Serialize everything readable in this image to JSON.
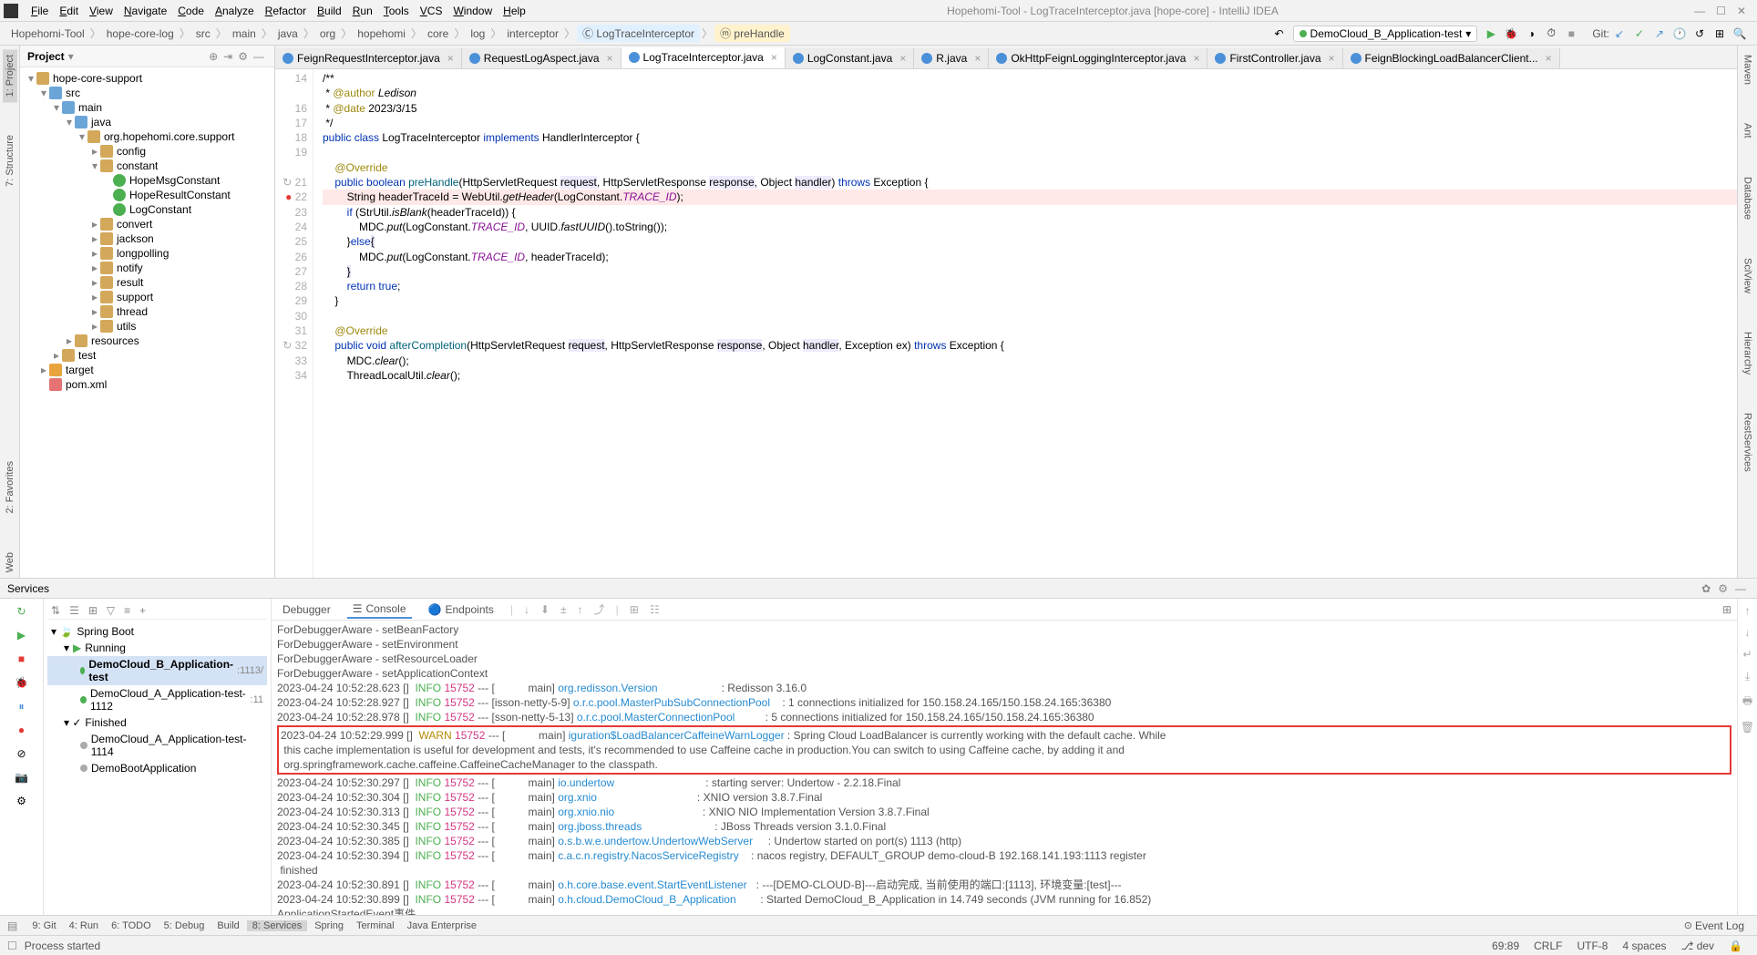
{
  "window_title": "Hopehomi-Tool - LogTraceInterceptor.java [hope-core] - IntelliJ IDEA",
  "menus": [
    "File",
    "Edit",
    "View",
    "Navigate",
    "Code",
    "Analyze",
    "Refactor",
    "Build",
    "Run",
    "Tools",
    "VCS",
    "Window",
    "Help"
  ],
  "breadcrumbs": [
    "Hopehomi-Tool",
    "hope-core-log",
    "src",
    "main",
    "java",
    "org",
    "hopehomi",
    "core",
    "log",
    "interceptor"
  ],
  "breadcrumb_class": "LogTraceInterceptor",
  "breadcrumb_method": "preHandle",
  "run_config": "DemoCloud_B_Application-test",
  "git_label": "Git:",
  "left_tabs": [
    "1: Project",
    "7: Structure"
  ],
  "right_tabs": [
    "Maven",
    "Ant",
    "Database",
    "SciView",
    "Hierarchy",
    "RestServices"
  ],
  "left_tabs2": [
    "2: Favorites",
    "Web"
  ],
  "project_panel_title": "Project",
  "tree": [
    {
      "indent": 0,
      "arrow": "▾",
      "icon": "folder",
      "label": "hope-core-support"
    },
    {
      "indent": 1,
      "arrow": "▾",
      "icon": "folder-blue",
      "label": "src"
    },
    {
      "indent": 2,
      "arrow": "▾",
      "icon": "folder-blue",
      "label": "main"
    },
    {
      "indent": 3,
      "arrow": "▾",
      "icon": "folder-blue",
      "label": "java"
    },
    {
      "indent": 4,
      "arrow": "▾",
      "icon": "folder",
      "label": "org.hopehomi.core.support"
    },
    {
      "indent": 5,
      "arrow": "▸",
      "icon": "folder",
      "label": "config"
    },
    {
      "indent": 5,
      "arrow": "▾",
      "icon": "folder",
      "label": "constant"
    },
    {
      "indent": 6,
      "arrow": "",
      "icon": "class-c",
      "label": "HopeMsgConstant"
    },
    {
      "indent": 6,
      "arrow": "",
      "icon": "class-c",
      "label": "HopeResultConstant"
    },
    {
      "indent": 6,
      "arrow": "",
      "icon": "class-c",
      "label": "LogConstant"
    },
    {
      "indent": 5,
      "arrow": "▸",
      "icon": "folder",
      "label": "convert"
    },
    {
      "indent": 5,
      "arrow": "▸",
      "icon": "folder",
      "label": "jackson"
    },
    {
      "indent": 5,
      "arrow": "▸",
      "icon": "folder",
      "label": "longpolling"
    },
    {
      "indent": 5,
      "arrow": "▸",
      "icon": "folder",
      "label": "notify"
    },
    {
      "indent": 5,
      "arrow": "▸",
      "icon": "folder",
      "label": "result"
    },
    {
      "indent": 5,
      "arrow": "▸",
      "icon": "folder",
      "label": "support"
    },
    {
      "indent": 5,
      "arrow": "▸",
      "icon": "folder",
      "label": "thread"
    },
    {
      "indent": 5,
      "arrow": "▸",
      "icon": "folder",
      "label": "utils"
    },
    {
      "indent": 3,
      "arrow": "▸",
      "icon": "folder",
      "label": "resources"
    },
    {
      "indent": 2,
      "arrow": "▸",
      "icon": "folder",
      "label": "test"
    },
    {
      "indent": 1,
      "arrow": "▸",
      "icon": "folder-orange",
      "label": "target"
    },
    {
      "indent": 1,
      "arrow": "",
      "icon": "xml",
      "label": "pom.xml"
    }
  ],
  "tabs": [
    {
      "label": "FeignRequestInterceptor.java",
      "active": false
    },
    {
      "label": "RequestLogAspect.java",
      "active": false
    },
    {
      "label": "LogTraceInterceptor.java",
      "active": true
    },
    {
      "label": "LogConstant.java",
      "active": false
    },
    {
      "label": "R.java",
      "active": false
    },
    {
      "label": "OkHttpFeignLoggingInterceptor.java",
      "active": false
    },
    {
      "label": "FirstController.java",
      "active": false
    },
    {
      "label": "FeignBlockingLoadBalancerClient...",
      "active": false
    }
  ],
  "code_lines": [
    {
      "n": 14,
      "html": "/**"
    },
    {
      "n": "",
      "html": " * <span class='anno'>@author</span> <i>Ledison</i>"
    },
    {
      "n": 16,
      "html": " * <span class='anno'>@date</span> 2023/3/15"
    },
    {
      "n": 17,
      "html": " */"
    },
    {
      "n": 18,
      "html": "<span class='kw'>public class</span> LogTraceInterceptor <span class='kw'>implements</span> HandlerInterceptor {"
    },
    {
      "n": 19,
      "html": ""
    },
    {
      "n": "",
      "html": "    <span class='anno'>@Override</span>"
    },
    {
      "n": 21,
      "html": "    <span class='kw'>public boolean</span> <span class='method-name'>preHandle</span>(HttpServletRequest <span class='hl-param'>request</span>, HttpServletResponse <span class='hl-param'>response</span>, Object <span class='hl-param'>handler</span>) <span class='kw'>throws</span> Exception {",
      "icon": "↻"
    },
    {
      "n": 22,
      "html": "        String headerTraceId = WebUtil.<i>getHeader</i>(LogConstant.<span class='field'>TRACE_ID</span>);",
      "bp": true
    },
    {
      "n": 23,
      "html": "        <span class='kw'>if</span> (StrUtil.<i>isBlank</i>(headerTraceId)) {"
    },
    {
      "n": 24,
      "html": "            MDC.<i>put</i>(LogConstant.<span class='field'>TRACE_ID</span>, UUID.<i>fastUUID</i>().toString());"
    },
    {
      "n": 25,
      "html": "        }<span class='kw'>else</span><span class='hl'>{</span>"
    },
    {
      "n": 26,
      "html": "            MDC.<i>put</i>(LogConstant.<span class='field'>TRACE_ID</span>, headerTraceId);"
    },
    {
      "n": 27,
      "html": "        <span class='hl'>}</span>"
    },
    {
      "n": 28,
      "html": "        <span class='kw'>return true</span>;"
    },
    {
      "n": 29,
      "html": "    }"
    },
    {
      "n": 30,
      "html": ""
    },
    {
      "n": 31,
      "html": "    <span class='anno'>@Override</span>"
    },
    {
      "n": 32,
      "html": "    <span class='kw'>public void</span> <span class='method-name'>afterCompletion</span>(HttpServletRequest <span class='hl-param'>request</span>, HttpServletResponse <span class='hl-param'>response</span>, Object <span class='hl-param'>handler</span>, Exception ex) <span class='kw'>throws</span> Exception {",
      "icon": "↻"
    },
    {
      "n": 33,
      "html": "        MDC.<i>clear</i>();"
    },
    {
      "n": 34,
      "html": "        ThreadLocalUtil.<i>clear</i>();"
    }
  ],
  "services_title": "Services",
  "services_tree_title": "Spring Boot",
  "services_running": "Running",
  "services_finished": "Finished",
  "services_items_running": [
    {
      "label": "DemoCloud_B_Application-test",
      "port": ":1113/",
      "selected": true
    },
    {
      "label": "DemoCloud_A_Application-test-1112",
      "port": ":11",
      "selected": false
    }
  ],
  "services_items_finished": [
    {
      "label": "DemoCloud_A_Application-test-1114"
    },
    {
      "label": "DemoBootApplication"
    }
  ],
  "console_tabs": [
    "Debugger",
    "Console",
    "Endpoints"
  ],
  "console_lines": [
    {
      "raw": "<span class='log-text'>ForDebuggerAware - setBeanFactory</span>"
    },
    {
      "raw": "<span class='log-text'>ForDebuggerAware - setEnvironment</span>"
    },
    {
      "raw": "<span class='log-text'>ForDebuggerAware - setResourceLoader</span>"
    },
    {
      "raw": "<span class='log-text'>ForDebuggerAware - setApplicationContext</span>"
    },
    {
      "raw": "<span class='log-text'>2023-04-24 10:52:28.623 []  </span><span class='log-info'>INFO</span> <span class='log-pid'>15752</span><span class='log-text'> --- [           main] </span><span class='log-logger'>org.redisson.Version</span><span class='log-text'>                     : Redisson 3.16.0</span>"
    },
    {
      "raw": "<span class='log-text'>2023-04-24 10:52:28.927 []  </span><span class='log-info'>INFO</span> <span class='log-pid'>15752</span><span class='log-text'> --- [isson-netty-5-9] </span><span class='log-logger'>o.r.c.pool.MasterPubSubConnectionPool</span><span class='log-text'>    : 1 connections initialized for 150.158.24.165/150.158.24.165:36380</span>"
    },
    {
      "raw": "<span class='log-text'>2023-04-24 10:52:28.978 []  </span><span class='log-info'>INFO</span> <span class='log-pid'>15752</span><span class='log-text'> --- [sson-netty-5-13] </span><span class='log-logger'>o.r.c.pool.MasterConnectionPool</span><span class='log-text'>          : 5 connections initialized for 150.158.24.165/150.158.24.165:36380</span>"
    },
    {
      "box": true,
      "raw": "<span class='log-text'>2023-04-24 10:52:29.999 []  </span><span class='log-warn'>WARN</span> <span class='log-pid'>15752</span><span class='log-text'> --- [           main] </span><span class='log-logger'>iguration$LoadBalancerCaffeineWarnLogger</span><span class='log-text'> : Spring Cloud LoadBalancer is currently working with the default cache. While \n this cache implementation is useful for development and tests, it's recommended to use Caffeine cache in production.You can switch to using Caffeine cache, by adding it and \n org.springframework.cache.caffeine.CaffeineCacheManager to the classpath.</span>"
    },
    {
      "raw": "<span class='log-text'>2023-04-24 10:52:30.297 []  </span><span class='log-info'>INFO</span> <span class='log-pid'>15752</span><span class='log-text'> --- [           main] </span><span class='log-logger'>io.undertow</span><span class='log-text'>                              : starting server: Undertow - 2.2.18.Final</span>"
    },
    {
      "raw": "<span class='log-text'>2023-04-24 10:52:30.304 []  </span><span class='log-info'>INFO</span> <span class='log-pid'>15752</span><span class='log-text'> --- [           main] </span><span class='log-logger'>org.xnio</span><span class='log-text'>                                 : XNIO version 3.8.7.Final</span>"
    },
    {
      "raw": "<span class='log-text'>2023-04-24 10:52:30.313 []  </span><span class='log-info'>INFO</span> <span class='log-pid'>15752</span><span class='log-text'> --- [           main] </span><span class='log-logger'>org.xnio.nio</span><span class='log-text'>                             : XNIO NIO Implementation Version 3.8.7.Final</span>"
    },
    {
      "raw": "<span class='log-text'>2023-04-24 10:52:30.345 []  </span><span class='log-info'>INFO</span> <span class='log-pid'>15752</span><span class='log-text'> --- [           main] </span><span class='log-logger'>org.jboss.threads</span><span class='log-text'>                        : JBoss Threads version 3.1.0.Final</span>"
    },
    {
      "raw": "<span class='log-text'>2023-04-24 10:52:30.385 []  </span><span class='log-info'>INFO</span> <span class='log-pid'>15752</span><span class='log-text'> --- [           main] </span><span class='log-logger'>o.s.b.w.e.undertow.UndertowWebServer</span><span class='log-text'>     : Undertow started on port(s) 1113 (http)</span>"
    },
    {
      "raw": "<span class='log-text'>2023-04-24 10:52:30.394 []  </span><span class='log-info'>INFO</span> <span class='log-pid'>15752</span><span class='log-text'> --- [           main] </span><span class='log-logger'>c.a.c.n.registry.NacosServiceRegistry</span><span class='log-text'>    : nacos registry, DEFAULT_GROUP demo-cloud-B 192.168.141.193:1113 register \n finished</span>"
    },
    {
      "raw": "<span class='log-text'>2023-04-24 10:52:30.891 []  </span><span class='log-info'>INFO</span> <span class='log-pid'>15752</span><span class='log-text'> --- [           main] </span><span class='log-logger'>o.h.core.base.event.StartEventListener</span><span class='log-text'>   : ---[DEMO-CLOUD-B]---启动完成, 当前使用的端口:[1113], 环境变量:[test]---</span>"
    },
    {
      "raw": "<span class='log-text'>2023-04-24 10:52:30.899 []  </span><span class='log-info'>INFO</span> <span class='log-pid'>15752</span><span class='log-text'> --- [           main] </span><span class='log-logger'>o.h.cloud.DemoCloud_B_Application</span><span class='log-text'>        : Started DemoCloud_B_Application in 14.749 seconds (JVM running for 16.852)</span>"
    },
    {
      "raw": "<span class='log-text'>ApplicationStartedEvent事件</span>"
    }
  ],
  "bottom_tabs": [
    "9: Git",
    "4: Run",
    "6: TODO",
    "5: Debug",
    "Build",
    "8: Services",
    "Spring",
    "Terminal",
    "Java Enterprise"
  ],
  "event_log": "Event Log",
  "status_msg": "Process started",
  "status_right": [
    "69:89",
    "CRLF",
    "UTF-8",
    "4 spaces",
    "dev"
  ]
}
